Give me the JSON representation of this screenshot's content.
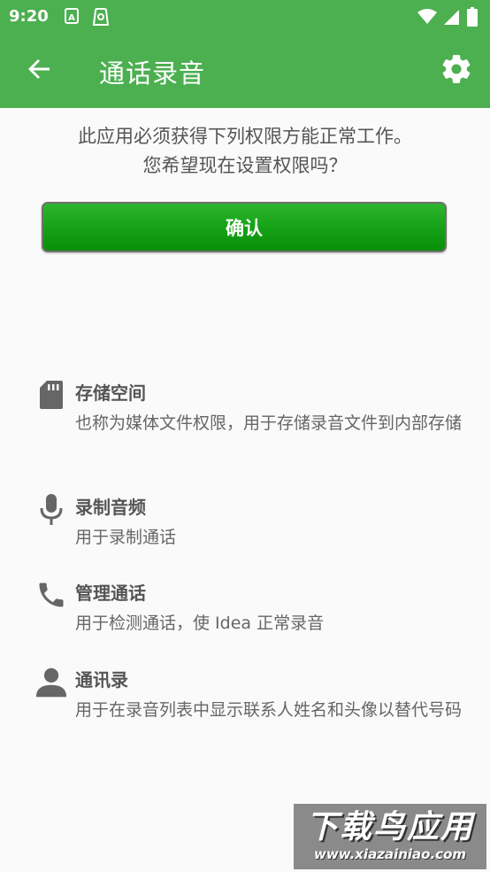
{
  "status_bar": {
    "time": "9:20",
    "left_icons": [
      "font-icon",
      "screen-record-icon"
    ],
    "right_icons": [
      "wifi-icon",
      "signal-icon",
      "battery-icon"
    ]
  },
  "app_bar": {
    "title": "通话录音",
    "color": "#4caf50"
  },
  "prompt": {
    "line1": "此应用必须获得下列权限方能正常工作。",
    "line2": "您希望现在设置权限吗？"
  },
  "confirm_button": {
    "label": "确认"
  },
  "permissions": [
    {
      "icon": "sd-card-icon",
      "title": "存储空间",
      "desc": "也称为媒体文件权限，用于存储录音文件到内部存储"
    },
    {
      "icon": "microphone-icon",
      "title": "录制音频",
      "desc": "用于录制通话"
    },
    {
      "icon": "phone-icon",
      "title": "管理通话",
      "desc": "用于检测通话，使 Idea 正常录音"
    },
    {
      "icon": "person-icon",
      "title": "通讯录",
      "desc": "用于在录音列表中显示联系人姓名和头像以替代号码"
    }
  ],
  "watermark": {
    "title": "下载鸟应用",
    "url": "www.xiazainiao.com"
  }
}
